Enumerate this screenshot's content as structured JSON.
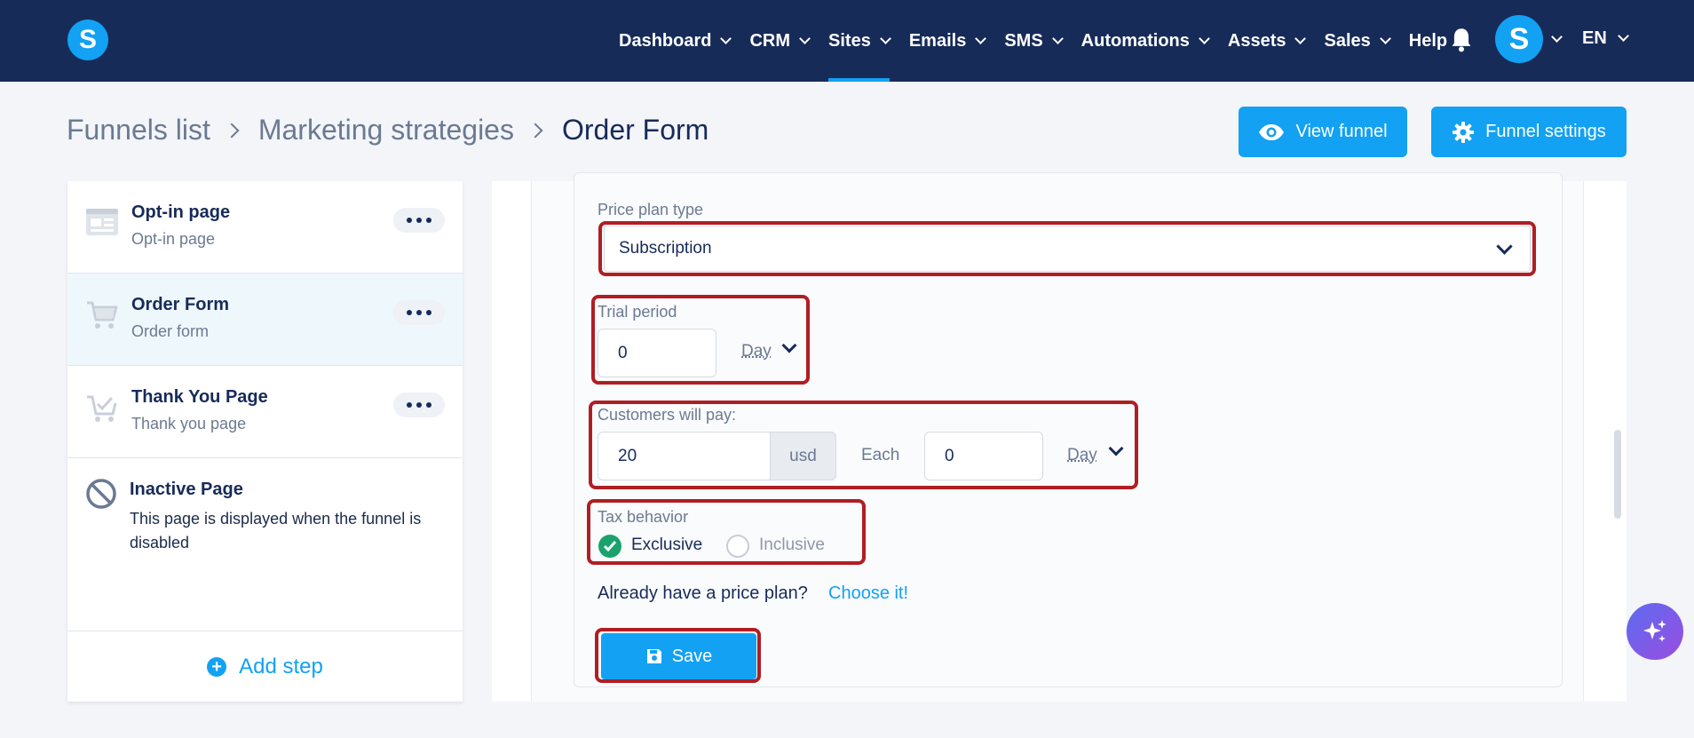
{
  "nav": {
    "items": [
      {
        "label": "Dashboard",
        "chevron": true
      },
      {
        "label": "CRM",
        "chevron": true
      },
      {
        "label": "Sites",
        "chevron": true,
        "active": true
      },
      {
        "label": "Emails",
        "chevron": true
      },
      {
        "label": "SMS",
        "chevron": true
      },
      {
        "label": "Automations",
        "chevron": true
      },
      {
        "label": "Assets",
        "chevron": true
      },
      {
        "label": "Sales",
        "chevron": true
      },
      {
        "label": "Help",
        "chevron": false
      }
    ],
    "logo_letter": "S",
    "avatar_letter": "S",
    "lang": "EN"
  },
  "breadcrumb": {
    "items": [
      "Funnels list",
      "Marketing strategies"
    ],
    "current": "Order Form"
  },
  "header_buttons": {
    "view": "View funnel",
    "settings": "Funnel settings"
  },
  "sidebar": {
    "steps": [
      {
        "title": "Opt-in page",
        "subtitle": "Opt-in page",
        "icon": "page-icon"
      },
      {
        "title": "Order Form",
        "subtitle": "Order form",
        "icon": "cart-icon",
        "selected": true
      },
      {
        "title": "Thank You Page",
        "subtitle": "Thank you page",
        "icon": "cart-check-icon"
      }
    ],
    "inactive": {
      "title": "Inactive Page",
      "description": "This page is displayed when the funnel is disabled"
    },
    "add_step": "Add step"
  },
  "form": {
    "price_plan_type": {
      "label": "Price plan type",
      "value": "Subscription"
    },
    "trial": {
      "label": "Trial period",
      "value": "0",
      "unit": "Day"
    },
    "pay": {
      "label": "Customers will pay:",
      "amount": "20",
      "currency": "usd",
      "each_label": "Each",
      "interval": "0",
      "unit": "Day"
    },
    "tax": {
      "label": "Tax behavior",
      "exclusive": "Exclusive",
      "inclusive": "Inclusive",
      "selected": "Exclusive"
    },
    "already": "Already have a price plan?",
    "choose": "Choose it!",
    "save": "Save"
  },
  "colors": {
    "nav_bg": "#172b59",
    "accent": "#12a1f3",
    "highlight": "#b01e24",
    "success": "#19a36b"
  }
}
